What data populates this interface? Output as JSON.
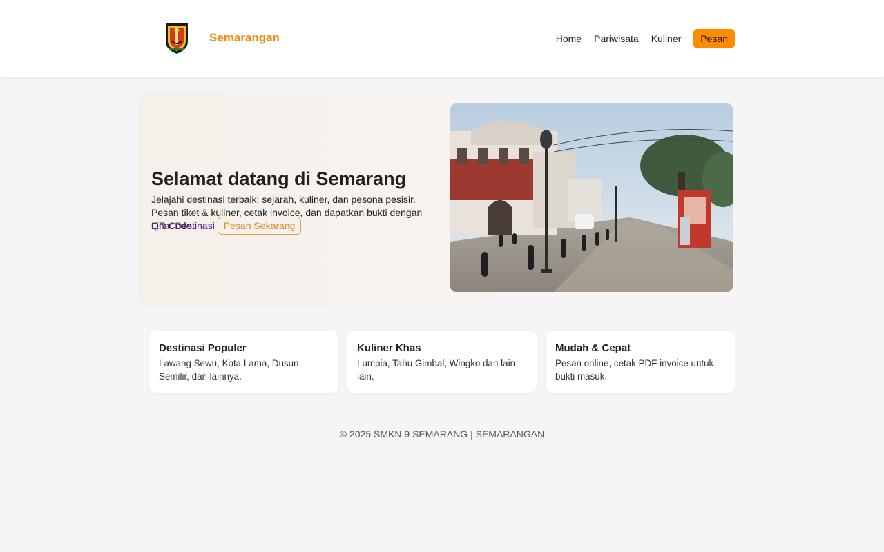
{
  "header": {
    "brand": "Semarangan",
    "logo_icon": "semarang-coat-of-arms-icon",
    "nav": [
      {
        "label": "Home"
      },
      {
        "label": "Pariwisata"
      },
      {
        "label": "Kuliner"
      },
      {
        "label": "Pesan"
      }
    ]
  },
  "hero": {
    "title": "Selamat datang di Semarang",
    "description": "Jelajahi destinasi terbaik: sejarah, kuliner, dan pesona pesisir. Pesan tiket & kuliner, cetak invoice, dan dapatkan bukti dengan QR Code.",
    "link_label": "Lihat Destinasi",
    "button_label": "Pesan Sekarang"
  },
  "cards": [
    {
      "title": "Destinasi Populer",
      "text": "Lawang Sewu, Kota Lama, Dusun Semilir, dan lainnya."
    },
    {
      "title": "Kuliner Khas",
      "text": "Lumpia, Tahu Gimbal, Wingko dan lain-lain."
    },
    {
      "title": "Mudah & Cepat",
      "text": "Pesan online, cetak PDF invoice untuk bukti masuk."
    }
  ],
  "footer": {
    "text": "© 2025 SMKN 9 SEMARANG | SEMARANGAN"
  },
  "colors": {
    "accent": "#ff8c00",
    "brand": "#f28c0f",
    "link": "#551a8b"
  }
}
